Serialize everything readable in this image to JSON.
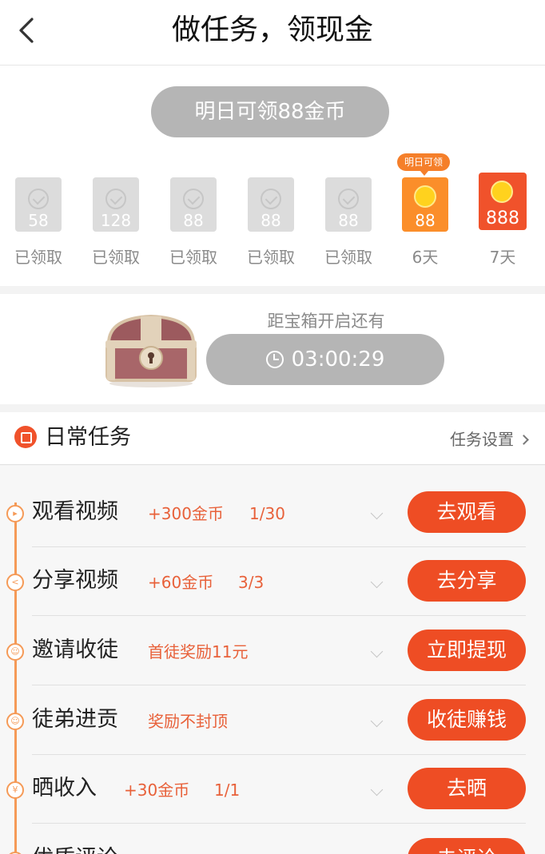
{
  "header": {
    "title": "做任务，领现金",
    "back_icon": "back-arrow-icon"
  },
  "checkin": {
    "top_pill": "明日可领88金币",
    "tomorrow_badge": "明日可领",
    "days": [
      {
        "amount": "58",
        "label": "已领取",
        "state": "claimed"
      },
      {
        "amount": "128",
        "label": "已领取",
        "state": "claimed"
      },
      {
        "amount": "88",
        "label": "已领取",
        "state": "claimed"
      },
      {
        "amount": "88",
        "label": "已领取",
        "state": "claimed"
      },
      {
        "amount": "88",
        "label": "已领取",
        "state": "claimed"
      },
      {
        "amount": "88",
        "label": "6天",
        "state": "next"
      },
      {
        "amount": "888",
        "label": "7天",
        "state": "bonus"
      }
    ]
  },
  "chest": {
    "caption": "距宝箱开启还有",
    "timer": "03:00:29",
    "icon": "treasure-chest-icon"
  },
  "daily": {
    "title": "日常任务",
    "settings_label": "任务设置"
  },
  "tasks": [
    {
      "name": "观看视频",
      "reward": "+300金币",
      "progress": "1/30",
      "button": "去观看",
      "icon": "play-icon"
    },
    {
      "name": "分享视频",
      "reward": "+60金币",
      "progress": "3/3",
      "button": "去分享",
      "icon": "share-icon"
    },
    {
      "name": "邀请收徒",
      "reward": "首徒奖励11元",
      "progress": "",
      "button": "立即提现",
      "icon": "user-icon"
    },
    {
      "name": "徒弟进贡",
      "reward": "奖励不封顶",
      "progress": "",
      "button": "收徒赚钱",
      "icon": "user-icon"
    },
    {
      "name": "晒收入",
      "reward": "+30金币",
      "progress": "1/1",
      "button": "去晒",
      "icon": "yen-icon"
    },
    {
      "name": "优质评论",
      "reward": "",
      "progress": "",
      "button": "去评论",
      "icon": "comment-icon"
    }
  ],
  "colors": {
    "accent": "#ee4d24",
    "accent_light": "#fb8e2a",
    "reward_text": "#e8613a",
    "pill_gray": "#b5b5b5"
  }
}
